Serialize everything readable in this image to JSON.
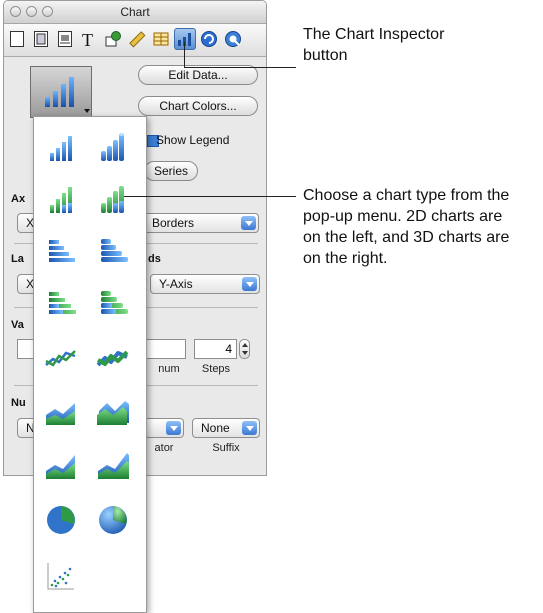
{
  "window": {
    "title": "Chart",
    "toolbar_icons": [
      "document-icon",
      "layout-icon",
      "wrap-icon",
      "text-icon",
      "graphic-icon",
      "metrics-icon",
      "table-icon",
      "chart-icon",
      "hyperlink-icon",
      "quicktime-icon"
    ]
  },
  "chart_inspector": {
    "edit_data": "Edit Data...",
    "chart_colors": "Chart Colors...",
    "show_legend": "Show Legend",
    "series": "Series",
    "axis_heading_partial": "Ax",
    "axis_popup_partial": "X",
    "borders_popup": "Borders",
    "labels_heading_partial": "La",
    "labels_heading_partial2": "ds",
    "labels_popup_partial": "X",
    "y_axis_popup": "Y-Axis",
    "values_heading_partial": "Va",
    "steps_value": "4",
    "minimum_partial": "num",
    "steps_label": "Steps",
    "number_heading_partial": "Nu",
    "number_popup_partial": "N",
    "separator_partial": "ator",
    "suffix_popup": "None",
    "suffix_label": "Suffix"
  },
  "chart_type_menu": {
    "items": [
      {
        "name": "2d-column"
      },
      {
        "name": "3d-column"
      },
      {
        "name": "2d-stacked-column"
      },
      {
        "name": "3d-stacked-column"
      },
      {
        "name": "2d-bar"
      },
      {
        "name": "3d-bar"
      },
      {
        "name": "2d-stacked-bar"
      },
      {
        "name": "3d-stacked-bar"
      },
      {
        "name": "2d-line"
      },
      {
        "name": "3d-line"
      },
      {
        "name": "2d-area"
      },
      {
        "name": "3d-area"
      },
      {
        "name": "2d-stacked-area"
      },
      {
        "name": "3d-stacked-area"
      },
      {
        "name": "2d-pie"
      },
      {
        "name": "3d-pie"
      },
      {
        "name": "scatter"
      }
    ]
  },
  "callouts": {
    "inspector_button_line1": "The Chart Inspector",
    "inspector_button_line2": "button",
    "chart_type_line1": "Choose a chart type from the",
    "chart_type_line2": "pop-up menu. 2D charts are",
    "chart_type_line3": "on the left, and 3D charts are",
    "chart_type_line4": "on the right."
  },
  "colors": {
    "blue_chart": "#2f74c9",
    "green_chart": "#2e9a46",
    "selected_button": "#5a8fd3"
  }
}
